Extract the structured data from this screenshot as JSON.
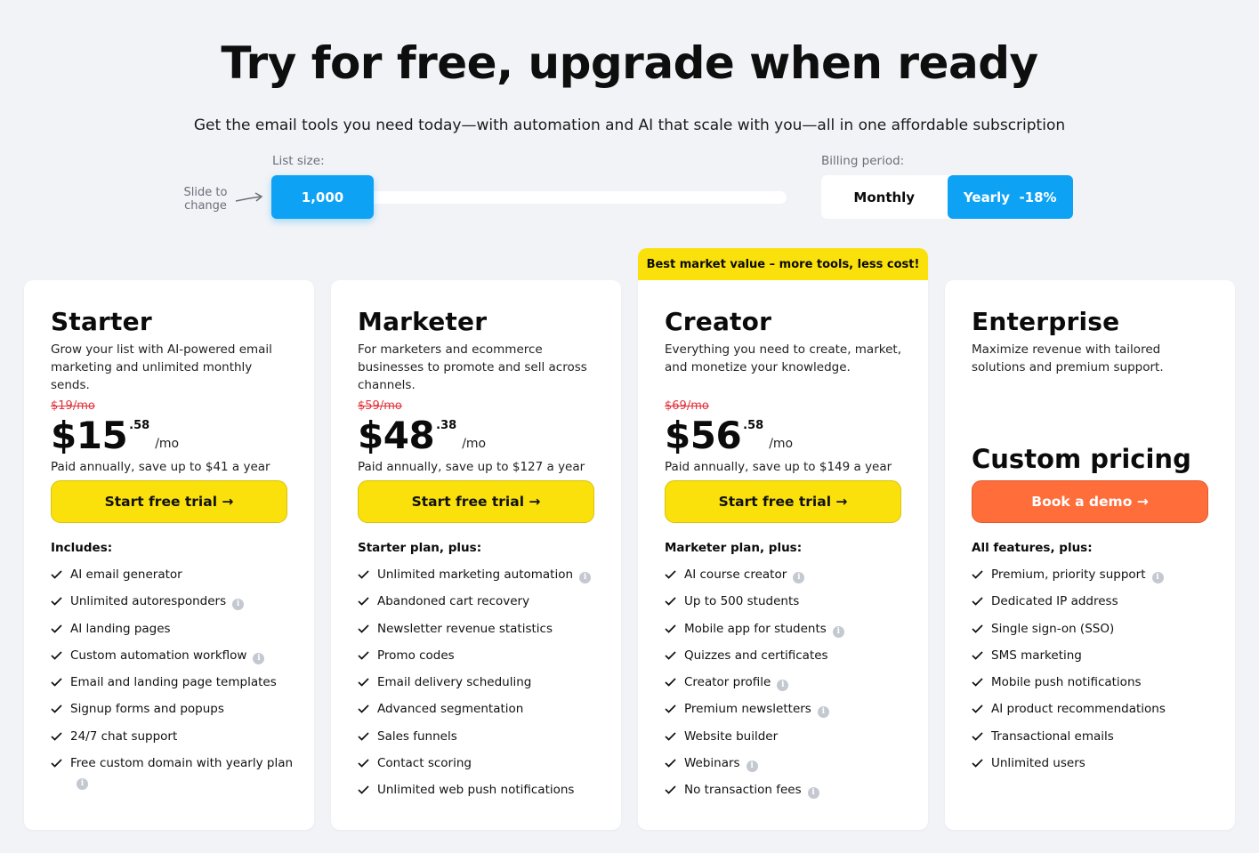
{
  "header": {
    "title": "Try for free, upgrade when ready",
    "subtitle": "Get the email tools you need today—with automation and AI that scale with you—all in one affordable subscription"
  },
  "controls": {
    "list_label": "List size:",
    "slide_hint": "Slide to change",
    "list_value": "1,000",
    "billing_label": "Billing period:",
    "billing_options": [
      "Monthly",
      "Yearly  -18%"
    ],
    "billing_selected": "Yearly"
  },
  "colors": {
    "accent_blue": "#0ea2f5",
    "cta_yellow": "#fae10c",
    "cta_orange": "#ff6d3b",
    "old_price_red": "#e1323a"
  },
  "plans": [
    {
      "name": "Starter",
      "description": "Grow your list with AI-powered email marketing and unlimited monthly sends.",
      "old_price": "$19/mo",
      "price": "$15",
      "cents": ".58",
      "per": "/mo",
      "save_note": "Paid annually, save up to $41 a year",
      "cta": "Start free trial →",
      "includes_title": "Includes:",
      "features": [
        {
          "text": "AI email generator",
          "info": false
        },
        {
          "text": "Unlimited autoresponders",
          "info": true
        },
        {
          "text": "AI landing pages",
          "info": false
        },
        {
          "text": "Custom automation workflow",
          "info": true
        },
        {
          "text": "Email and landing page templates",
          "info": false
        },
        {
          "text": "Signup forms and popups",
          "info": false
        },
        {
          "text": "24/7 chat support",
          "info": false
        },
        {
          "text": "Free custom domain with yearly plan",
          "info": true
        }
      ]
    },
    {
      "name": "Marketer",
      "description": "For marketers and ecommerce businesses to promote and sell across channels.",
      "old_price": "$59/mo",
      "price": "$48",
      "cents": ".38",
      "per": "/mo",
      "save_note": "Paid annually, save up to $127 a year",
      "cta": "Start free trial →",
      "includes_title": "Starter plan, plus:",
      "features": [
        {
          "text": "Unlimited marketing automation",
          "info": true
        },
        {
          "text": "Abandoned cart recovery",
          "info": false
        },
        {
          "text": "Newsletter revenue statistics",
          "info": false
        },
        {
          "text": "Promo codes",
          "info": false
        },
        {
          "text": "Email delivery scheduling",
          "info": false
        },
        {
          "text": "Advanced segmentation",
          "info": false
        },
        {
          "text": "Sales funnels",
          "info": false
        },
        {
          "text": "Contact scoring",
          "info": false
        },
        {
          "text": "Unlimited web push notifications",
          "info": false
        }
      ]
    },
    {
      "name": "Creator",
      "ribbon": "Best market value – more tools, less cost!",
      "description": "Everything you need to create, market, and monetize your knowledge.",
      "old_price": "$69/mo",
      "price": "$56",
      "cents": ".58",
      "per": "/mo",
      "save_note": "Paid annually, save up to $149 a year",
      "cta": "Start free trial →",
      "includes_title": "Marketer plan, plus:",
      "features": [
        {
          "text": "AI course creator",
          "info": true
        },
        {
          "text": "Up to 500 students",
          "info": false
        },
        {
          "text": "Mobile app for students",
          "info": true
        },
        {
          "text": "Quizzes and certificates",
          "info": false
        },
        {
          "text": "Creator profile",
          "info": true
        },
        {
          "text": "Premium newsletters",
          "info": true
        },
        {
          "text": "Website builder",
          "info": false
        },
        {
          "text": "Webinars",
          "info": true
        },
        {
          "text": "No transaction fees",
          "info": true
        }
      ]
    },
    {
      "name": "Enterprise",
      "description": "Maximize revenue with tailored solutions and premium support.",
      "custom_price": "Custom pricing",
      "cta": "Book a demo →",
      "includes_title": "All features, plus:",
      "features": [
        {
          "text": "Premium, priority support",
          "info": true
        },
        {
          "text": "Dedicated IP address",
          "info": false
        },
        {
          "text": "Single sign-on (SSO)",
          "info": false
        },
        {
          "text": "SMS marketing",
          "info": false
        },
        {
          "text": "Mobile push notifications",
          "info": false
        },
        {
          "text": "AI product recommendations",
          "info": false
        },
        {
          "text": "Transactional emails",
          "info": false
        },
        {
          "text": "Unlimited users",
          "info": false
        }
      ]
    }
  ]
}
